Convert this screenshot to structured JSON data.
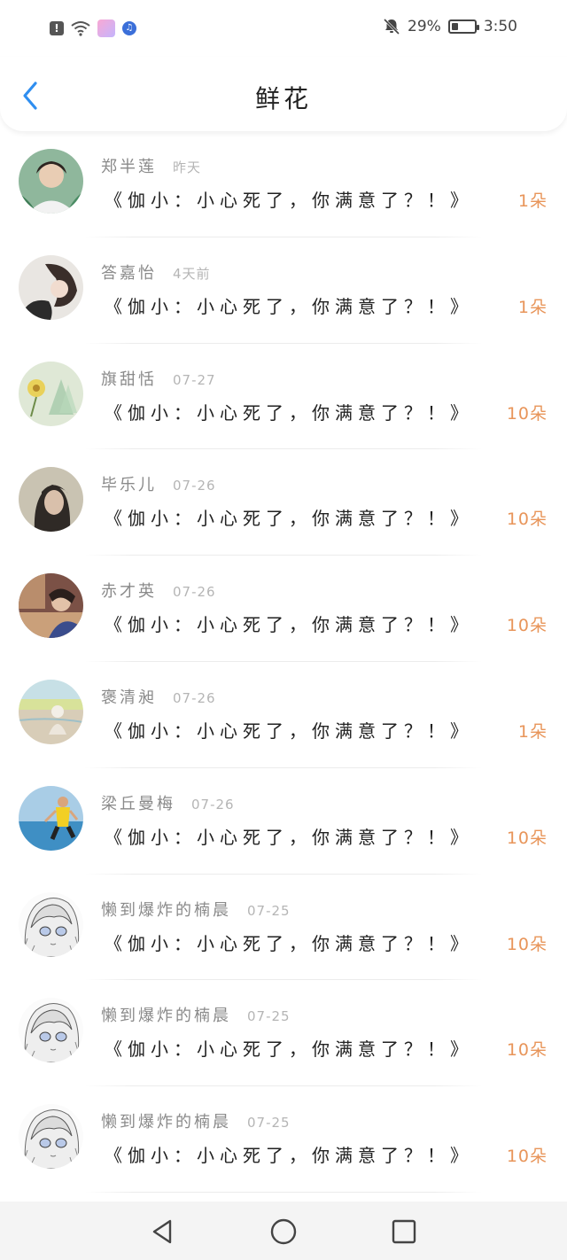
{
  "status_bar": {
    "battery_percent": "29%",
    "battery_level": 0.29,
    "time": "3:50",
    "icons": [
      "alert-icon",
      "wifi-icon",
      "app-icon",
      "music-icon",
      "bell-off-icon",
      "battery-icon"
    ]
  },
  "header": {
    "title": "鲜花",
    "back_icon": "chevron-left-icon"
  },
  "colors": {
    "back_icon": "#2f8ef0",
    "count_text": "#e8955a",
    "name_text": "#8a8a8a",
    "time_text": "#b5b5b5"
  },
  "items": [
    {
      "name": "郑半莲",
      "time": "昨天",
      "message": "《伽小：小心死了，你满意了？！》",
      "count": "1朵"
    },
    {
      "name": "答嘉怡",
      "time": "4天前",
      "message": "《伽小：小心死了，你满意了？！》",
      "count": "1朵"
    },
    {
      "name": "旗甜恬",
      "time": "07-27",
      "message": "《伽小：小心死了，你满意了？！》",
      "count": "10朵"
    },
    {
      "name": "毕乐儿",
      "time": "07-26",
      "message": "《伽小：小心死了，你满意了？！》",
      "count": "10朵"
    },
    {
      "name": "赤才英",
      "time": "07-26",
      "message": "《伽小：小心死了，你满意了？！》",
      "count": "10朵"
    },
    {
      "name": "褒清昶",
      "time": "07-26",
      "message": "《伽小：小心死了，你满意了？！》",
      "count": "1朵"
    },
    {
      "name": "梁丘曼梅",
      "time": "07-26",
      "message": "《伽小：小心死了，你满意了？！》",
      "count": "10朵"
    },
    {
      "name": "懒到爆炸的楠晨",
      "time": "07-25",
      "message": "《伽小：小心死了，你满意了？！》",
      "count": "10朵"
    },
    {
      "name": "懒到爆炸的楠晨",
      "time": "07-25",
      "message": "《伽小：小心死了，你满意了？！》",
      "count": "10朵"
    },
    {
      "name": "懒到爆炸的楠晨",
      "time": "07-25",
      "message": "《伽小：小心死了，你满意了？！》",
      "count": "10朵"
    }
  ],
  "nav_bar": {
    "icons": [
      "back-triangle-icon",
      "home-circle-icon",
      "recents-square-icon"
    ]
  }
}
